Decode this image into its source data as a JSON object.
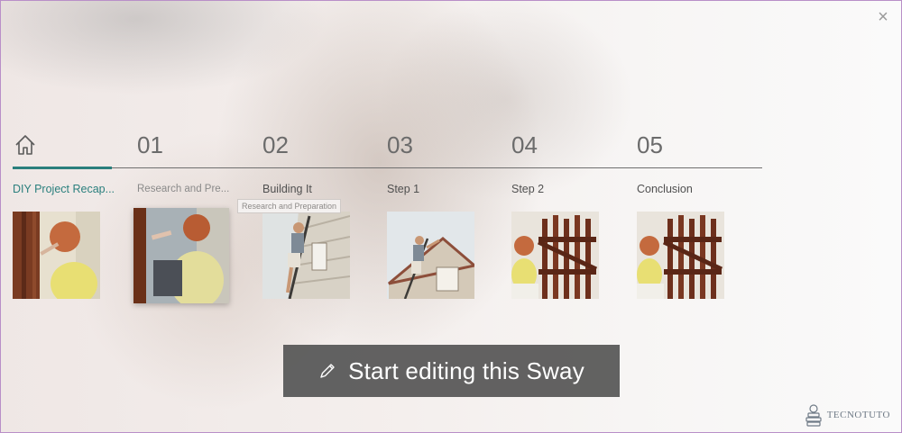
{
  "close_label": "×",
  "tabs": [
    {
      "id": "home",
      "label": "",
      "icon": "home-icon",
      "active": true
    },
    {
      "id": "01",
      "label": "01"
    },
    {
      "id": "02",
      "label": "02"
    },
    {
      "id": "03",
      "label": "03"
    },
    {
      "id": "04",
      "label": "04"
    },
    {
      "id": "05",
      "label": "05"
    }
  ],
  "sections": [
    {
      "title": "DIY Project Recap...",
      "image": "woman painting fence photo",
      "active": true
    },
    {
      "title": "Research and Pre...",
      "image": "woman painting fence closeup photo"
    },
    {
      "title": "Building It",
      "image": "man on ladder painting house photo"
    },
    {
      "title": "Step 1",
      "image": "man on ladder at house gable photo"
    },
    {
      "title": "Step 2",
      "image": "woman painting gate photo"
    },
    {
      "title": "Conclusion",
      "image": "woman painting gate photo"
    }
  ],
  "tooltip": "Research and Preparation",
  "cta": {
    "label": "Start editing this Sway",
    "icon": "pencil-icon"
  },
  "watermark": "TECNOTUTO",
  "colors": {
    "accent": "#2a7f7d",
    "cta_bg": "#555555"
  }
}
